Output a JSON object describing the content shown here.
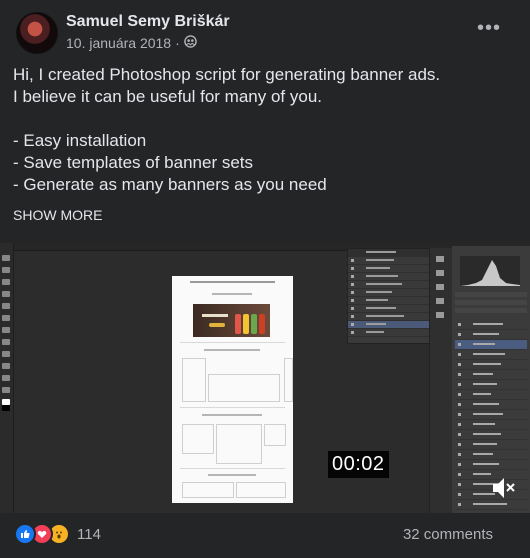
{
  "post": {
    "author": "Samuel Semy Briškár",
    "date": "10. januára 2018",
    "date_separator": "·",
    "privacy_icon": "friends-icon",
    "more_icon": "•••",
    "body_lines": [
      "Hi, I created Photoshop script for generating banner ads.",
      "I believe it can be useful for many of you.",
      "",
      "- Easy installation",
      "- Save templates of banner sets",
      "- Generate as many banners as you need"
    ],
    "show_more": "SHOW MORE"
  },
  "video": {
    "timecode": "00:02",
    "mute_icon": "speaker-muted-icon"
  },
  "engagement": {
    "reaction_icons": [
      "like-icon",
      "love-icon",
      "wow-icon"
    ],
    "reaction_count": "114",
    "comments": "32 comments"
  },
  "colors": {
    "background": "#242526",
    "text_primary": "#e4e6eb",
    "text_secondary": "#b0b3b8",
    "like": "#1877f2",
    "love": "#f33e58",
    "wow": "#f7b125"
  }
}
